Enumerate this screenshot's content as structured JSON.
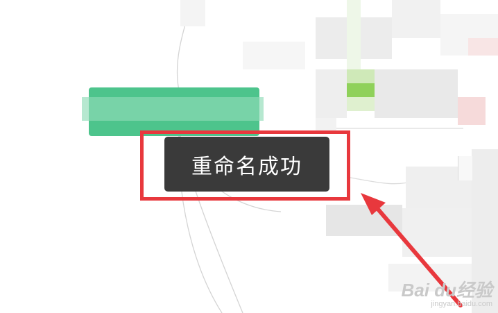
{
  "toast": {
    "message": "重命名成功"
  },
  "annotation": {
    "highlight_color": "#e8383d",
    "arrow_color": "#e8383d"
  },
  "node": {
    "fill": "#4dc48c"
  },
  "watermark": {
    "brand": "Bai du经验",
    "url": "jingyan.baidu.com"
  }
}
